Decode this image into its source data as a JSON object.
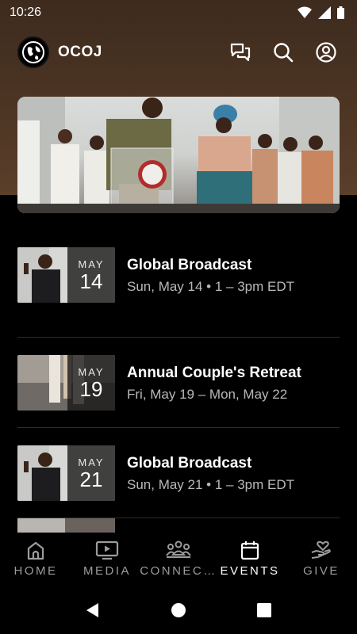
{
  "status_bar": {
    "time": "10:26"
  },
  "app": {
    "title": "OCOJ"
  },
  "events": [
    {
      "month": "MAY",
      "day": "14",
      "title": "Global Broadcast",
      "subtitle": "Sun, May 14 • 1 – 3pm EDT"
    },
    {
      "month": "MAY",
      "day": "19",
      "title": "Annual Couple's Retreat",
      "subtitle": "Fri, May 19 – Mon, May 22"
    },
    {
      "month": "MAY",
      "day": "21",
      "title": "Global Broadcast",
      "subtitle": "Sun, May 21 • 1 – 3pm EDT"
    }
  ],
  "bottom_nav": {
    "items": [
      {
        "label": "HOME",
        "icon": "church-icon"
      },
      {
        "label": "MEDIA",
        "icon": "play-icon"
      },
      {
        "label": "CONNEC…",
        "icon": "people-icon"
      },
      {
        "label": "EVENTS",
        "icon": "calendar-icon",
        "active": true
      },
      {
        "label": "GIVE",
        "icon": "hand-heart-icon"
      }
    ]
  },
  "colors": {
    "background": "#000000",
    "header_brown": "#4a3322",
    "muted_text": "#b9b9b9"
  }
}
